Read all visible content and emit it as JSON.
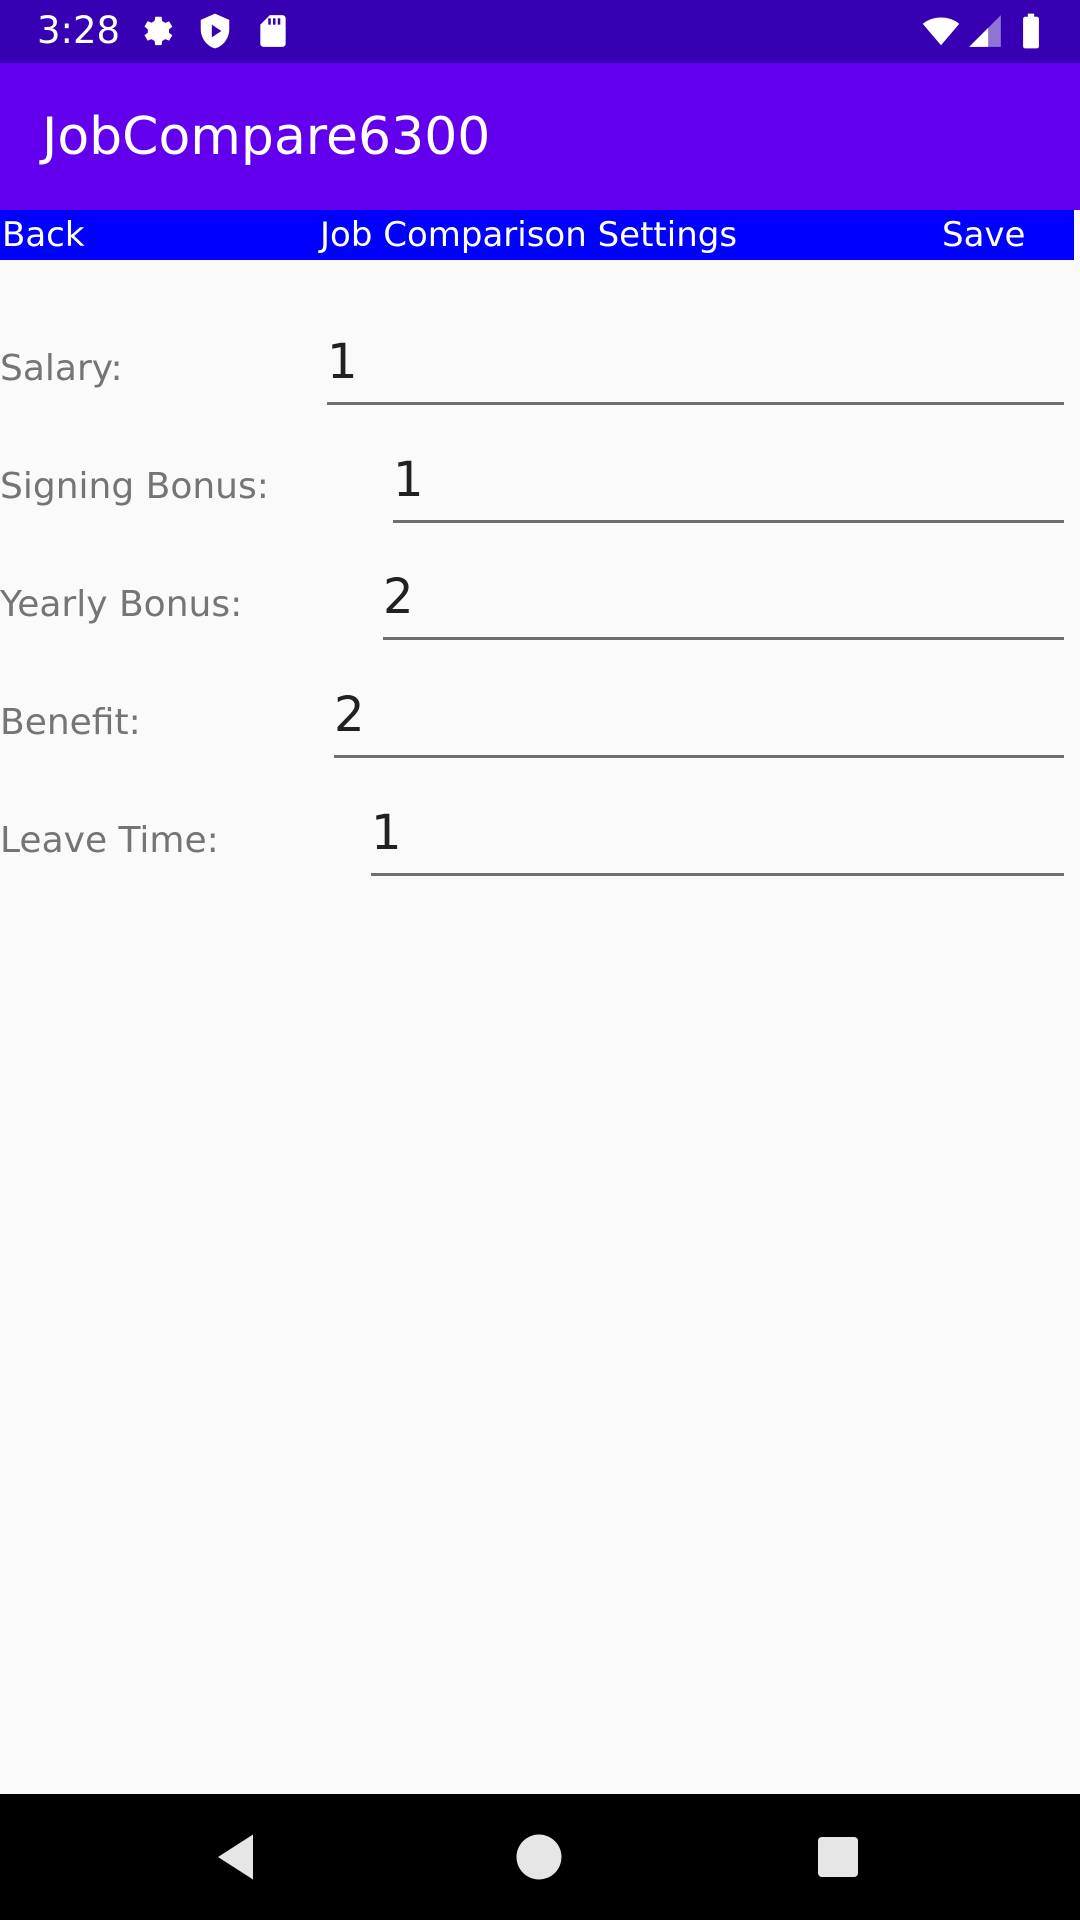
{
  "status_bar": {
    "time": "3:28",
    "left_icons": [
      "gear-icon",
      "shield-play-icon",
      "sd-card-icon"
    ],
    "right_icons": [
      "wifi-icon",
      "signal-icon",
      "battery-icon"
    ]
  },
  "app_bar": {
    "title": "JobCompare6300",
    "color": "#6200ee"
  },
  "nav_strip": {
    "back_label": "Back",
    "title": "Job Comparison Settings",
    "save_label": "Save",
    "color": "#0000ff"
  },
  "fields": [
    {
      "label": "Salary:",
      "value": "1"
    },
    {
      "label": "Signing Bonus:",
      "value": "1"
    },
    {
      "label": "Yearly Bonus:",
      "value": "2"
    },
    {
      "label": "Benefit:",
      "value": "2"
    },
    {
      "label": "Leave Time:",
      "value": "1"
    }
  ],
  "system_nav": {
    "icons": [
      "back-triangle-icon",
      "home-circle-icon",
      "recents-square-icon"
    ]
  }
}
